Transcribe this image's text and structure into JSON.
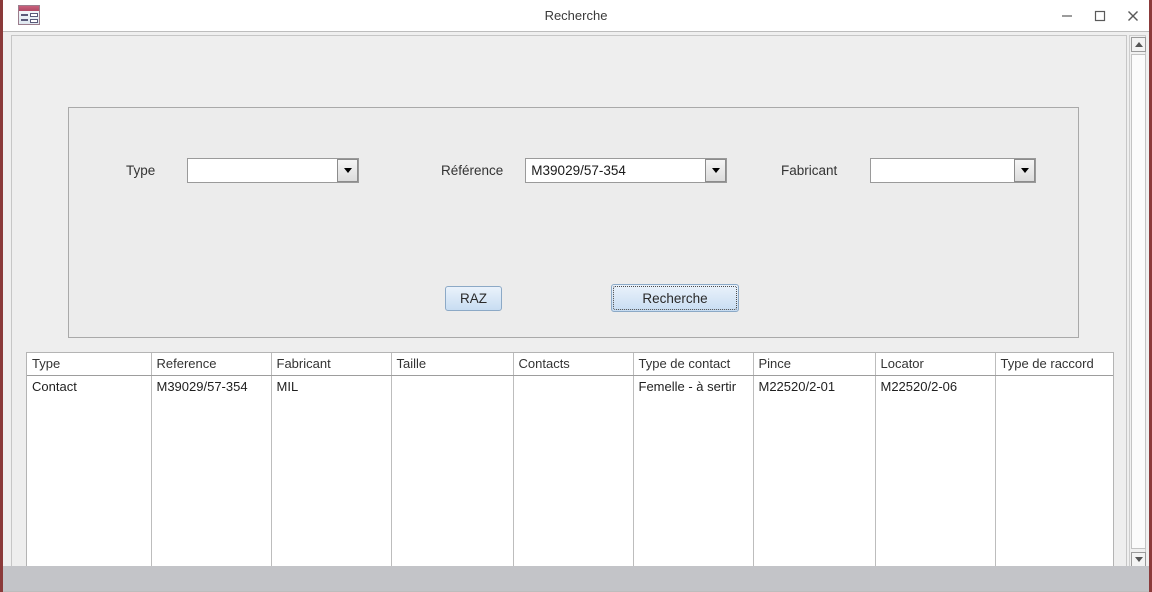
{
  "window": {
    "title": "Recherche",
    "icon": "access-form-icon",
    "controls": {
      "minimize": "minimize-icon",
      "maximize": "maximize-icon",
      "close": "close-icon"
    }
  },
  "criteria": {
    "fields": [
      {
        "label": "Type",
        "value": "",
        "placeholder": ""
      },
      {
        "label": "Référence",
        "value": "M39029/57-354",
        "placeholder": ""
      },
      {
        "label": "Fabricant",
        "value": "",
        "placeholder": ""
      }
    ],
    "buttons": {
      "reset": "RAZ",
      "search": "Recherche"
    }
  },
  "results": {
    "columns": [
      "Type",
      "Reference",
      "Fabricant",
      "Taille",
      "Contacts",
      "Type de contact",
      "Pince",
      "Locator",
      "Type de raccord"
    ],
    "rows": [
      {
        "type": "Contact",
        "reference": "M39029/57-354",
        "fabricant": "MIL",
        "taille": "",
        "contacts": "",
        "type_de_contact": "Femelle - à sertir",
        "pince": "M22520/2-01",
        "locator": "M22520/2-06",
        "type_de_raccord": ""
      }
    ]
  },
  "scrollbar": {
    "up": "scroll-up-icon",
    "down": "scroll-down-icon"
  },
  "colors": {
    "frame_border": "#8b3a3a",
    "client_bg": "#eeeeee",
    "button_accent": "#c8ddf2",
    "status_bar": "#c3c4c8"
  }
}
